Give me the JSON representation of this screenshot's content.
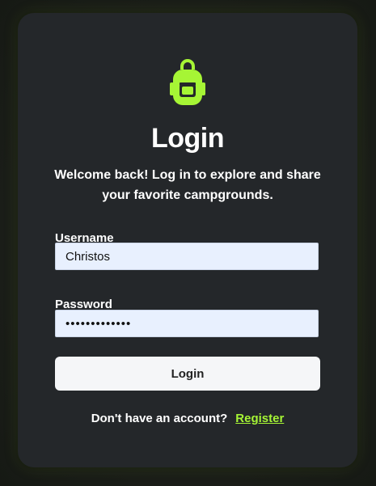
{
  "colors": {
    "accent": "#a6f535",
    "card_background": "#24272a",
    "input_background": "#e8f0fe",
    "button_background": "#f5f6f8"
  },
  "logo": {
    "icon": "backpack-icon"
  },
  "header": {
    "title": "Login",
    "subtitle": "Welcome back! Log in to explore and share your favorite campgrounds."
  },
  "form": {
    "username": {
      "label": "Username",
      "value": "Christos"
    },
    "password": {
      "label": "Password",
      "value": "•••••••••••••"
    },
    "submit_label": "Login"
  },
  "footer": {
    "prompt": "Don't have an account?",
    "register_link": "Register"
  }
}
